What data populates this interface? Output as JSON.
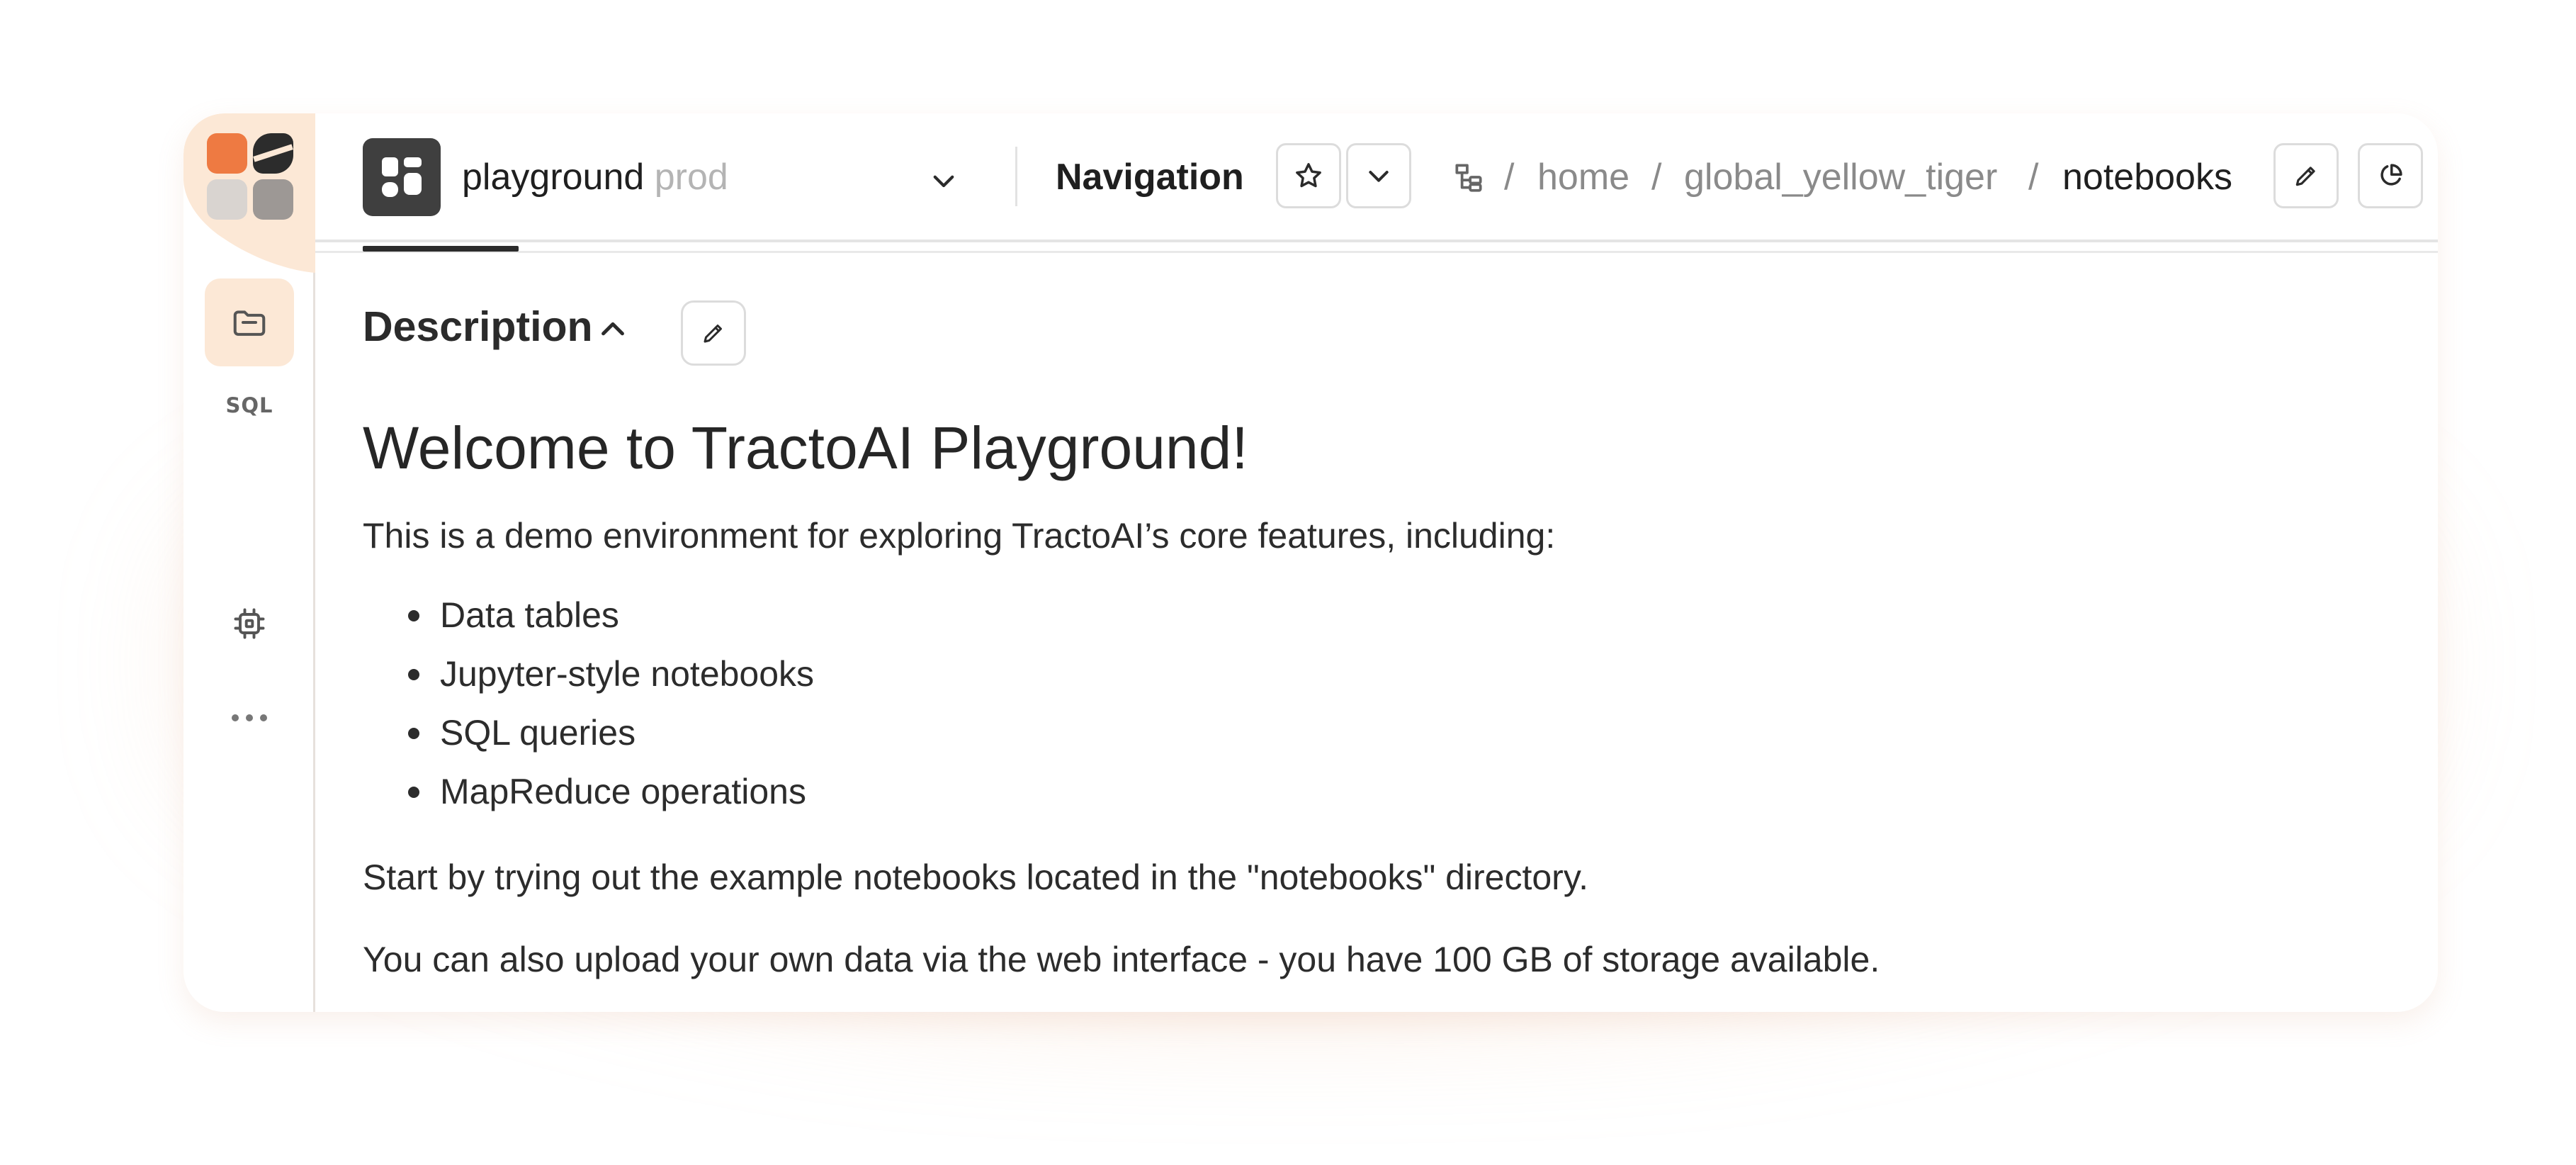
{
  "header": {
    "project_name": "playground",
    "project_env": "prod",
    "nav_label": "Navigation",
    "breadcrumb": [
      "home",
      "global_yellow_tiger",
      "notebooks"
    ],
    "separator": "/"
  },
  "sidebar": {
    "items": [
      {
        "name": "files",
        "icon": "folder-icon"
      },
      {
        "name": "sql",
        "label": "SQL"
      },
      {
        "name": "compute",
        "icon": "chip-icon"
      },
      {
        "name": "more",
        "icon": "more-icon"
      }
    ]
  },
  "content": {
    "section_title": "Description",
    "heading": "Welcome to TractoAI Playground!",
    "intro": "This is a demo environment for exploring TractoAI’s core features, including:",
    "features": [
      "Data tables",
      "Jupyter-style notebooks",
      "SQL queries",
      "MapReduce operations"
    ],
    "paragraph_1": "Start by trying out the example notebooks located in the \"notebooks\" directory.",
    "paragraph_2": "You can also upload your own data via the web interface - you have 100 GB of storage available."
  },
  "colors": {
    "accent": "#ee7a42",
    "rail_highlight": "#fce8d6",
    "glow": "#eebe9b"
  }
}
